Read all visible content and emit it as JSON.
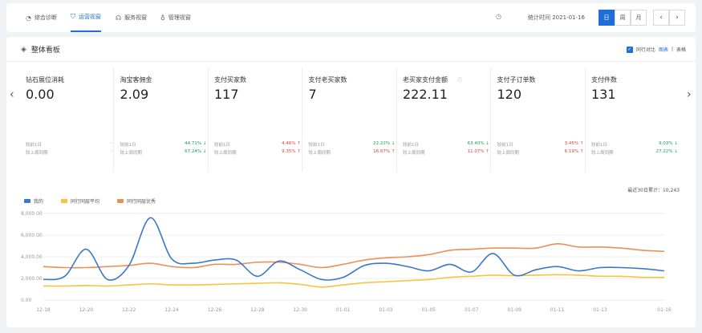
{
  "tabs": [
    {
      "label": "综合诊断",
      "icon": "gauge-icon",
      "active": false
    },
    {
      "label": "运营视窗",
      "icon": "shield-icon",
      "active": true
    },
    {
      "label": "服务视窗",
      "icon": "headset-icon",
      "active": false
    },
    {
      "label": "管理视窗",
      "icon": "bulb-icon",
      "active": false
    }
  ],
  "stats_time": "统计时间 2021-01-16",
  "period": [
    "日",
    "周",
    "月"
  ],
  "period_active": "日",
  "panel": {
    "title": "整体看板",
    "compare_label": "同行对比",
    "view_chart": "图表",
    "view_table": "表格"
  },
  "cards": [
    {
      "label": "钻石展位消耗",
      "value": "0.00",
      "r1_label": "较前1日",
      "r1_value": "-",
      "r1_dir": "",
      "r2_label": "较上周同期",
      "r2_value": "-",
      "r2_dir": ""
    },
    {
      "label": "淘宝客佣金",
      "value": "2.09",
      "r1_label": "较前1日",
      "r1_value": "44.71%",
      "r1_dir": "down",
      "r2_label": "较上周同期",
      "r2_value": "67.24%",
      "r2_dir": "down"
    },
    {
      "label": "支付买家数",
      "value": "117",
      "r1_label": "较前1日",
      "r1_value": "4.46%",
      "r1_dir": "up",
      "r2_label": "较上周同期",
      "r2_value": "9.35%",
      "r2_dir": "up"
    },
    {
      "label": "支付老买家数",
      "value": "7",
      "r1_label": "较前1日",
      "r1_value": "22.22%",
      "r1_dir": "down",
      "r2_label": "较上周同期",
      "r2_value": "16.67%",
      "r2_dir": "up"
    },
    {
      "label": "老买家支付金额",
      "value": "222.11",
      "r1_label": "较前1日",
      "r1_value": "63.40%",
      "r1_dir": "down",
      "r2_label": "较上周同期",
      "r2_value": "11.07%",
      "r2_dir": "up"
    },
    {
      "label": "支付子订单数",
      "value": "120",
      "r1_label": "较前1日",
      "r1_value": "3.45%",
      "r1_dir": "up",
      "r2_label": "较上周同期",
      "r2_value": "6.19%",
      "r2_dir": "up"
    },
    {
      "label": "支付件数",
      "value": "131",
      "r1_label": "较前1日",
      "r1_value": "9.03%",
      "r1_dir": "down",
      "r2_label": "较上周同期",
      "r2_value": "27.22%",
      "r2_dir": "down"
    }
  ],
  "chart_total": "最近30日累计：10,243",
  "chart_data": {
    "type": "line",
    "x": [
      "12-18",
      "12-19",
      "12-20",
      "12-21",
      "12-22",
      "12-23",
      "12-24",
      "12-25",
      "12-26",
      "12-27",
      "12-28",
      "12-29",
      "12-30",
      "12-31",
      "01-01",
      "01-02",
      "01-03",
      "01-04",
      "01-05",
      "01-06",
      "01-07",
      "01-08",
      "01-09",
      "01-10",
      "01-11",
      "01-12",
      "01-13",
      "01-14",
      "01-15",
      "01-16"
    ],
    "xticks": [
      "12-18",
      "12-20",
      "12-22",
      "12-24",
      "12-26",
      "12-28",
      "12-30",
      "01-01",
      "01-03",
      "01-05",
      "01-07",
      "01-09",
      "01-11",
      "01-13",
      "01-16"
    ],
    "yticks": [
      "0.00",
      "2,000.00",
      "4,000.00",
      "6,000.00",
      "8,000.00"
    ],
    "ylim": [
      0,
      8000
    ],
    "series": [
      {
        "name": "我的",
        "color": "#3a78c9",
        "values": [
          1900,
          2200,
          4700,
          1900,
          3200,
          7600,
          3800,
          3400,
          3700,
          3700,
          2200,
          3600,
          2800,
          1900,
          2100,
          3200,
          3400,
          3100,
          2700,
          3300,
          2600,
          4300,
          2300,
          2800,
          3100,
          2700,
          3000,
          3000,
          2900,
          2700
        ]
      },
      {
        "name": "同行同层平均",
        "color": "#f5c542",
        "values": [
          1300,
          1300,
          1350,
          1300,
          1400,
          1500,
          1400,
          1400,
          1450,
          1500,
          1550,
          1600,
          1450,
          1200,
          1400,
          1600,
          1700,
          1800,
          1900,
          2100,
          2200,
          2300,
          2250,
          2300,
          2350,
          2300,
          2200,
          2200,
          2100,
          2100
        ]
      },
      {
        "name": "同行同层优秀",
        "color": "#ec8f58",
        "values": [
          3100,
          3000,
          3000,
          3100,
          3200,
          3400,
          3100,
          3000,
          3300,
          3300,
          3500,
          3500,
          3300,
          3000,
          3300,
          3700,
          3900,
          4000,
          4200,
          4600,
          4700,
          4800,
          4800,
          4800,
          5200,
          4900,
          4900,
          4800,
          4600,
          4500
        ]
      }
    ]
  }
}
